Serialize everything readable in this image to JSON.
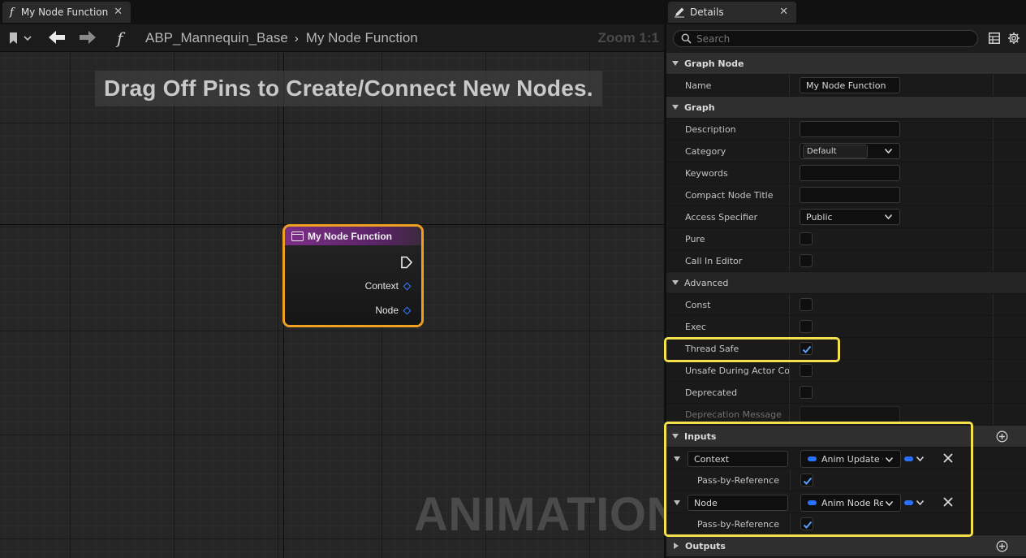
{
  "graph": {
    "tab_title": "My Node Function",
    "tab_close": "✕",
    "breadcrumb": [
      "ABP_Mannequin_Base",
      "My Node Function"
    ],
    "breadcrumb_sep": "›",
    "zoom": "Zoom 1:1",
    "hint": "Drag Off Pins to Create/Connect New Nodes.",
    "watermark": "ANIMATION",
    "node": {
      "title": "My Node Function",
      "pins": [
        "Context",
        "Node"
      ]
    },
    "colors": {
      "node_border": "#f0a020",
      "node_header": "#7b2f86",
      "pin": "#2e7dff"
    }
  },
  "details": {
    "tab_title": "Details",
    "tab_close": "✕",
    "search_placeholder": "Search",
    "sections": {
      "graph_node": "Graph Node",
      "graph": "Graph",
      "advanced": "Advanced",
      "inputs": "Inputs",
      "outputs": "Outputs"
    },
    "props": {
      "name_label": "Name",
      "name_value": "My Node Function",
      "description_label": "Description",
      "description_value": "",
      "category_label": "Category",
      "category_value": "Default",
      "keywords_label": "Keywords",
      "keywords_value": "",
      "compact_title_label": "Compact Node Title",
      "compact_title_value": "",
      "access_label": "Access Specifier",
      "access_value": "Public",
      "pure_label": "Pure",
      "pure_checked": false,
      "call_in_editor_label": "Call In Editor",
      "call_in_editor_checked": false,
      "const_label": "Const",
      "const_checked": false,
      "exec_label": "Exec",
      "exec_checked": false,
      "thread_safe_label": "Thread Safe",
      "thread_safe_checked": true,
      "unsafe_label": "Unsafe During Actor Cons",
      "unsafe_checked": false,
      "deprecated_label": "Deprecated",
      "deprecated_checked": false,
      "deprecation_msg_label": "Deprecation Message",
      "deprecation_msg_value": ""
    },
    "inputs": [
      {
        "name": "Context",
        "type": "Anim Update Context",
        "pass_by_ref_label": "Pass-by-Reference",
        "pass_by_ref": true
      },
      {
        "name": "Node",
        "type": "Anim Node Reference",
        "pass_by_ref_label": "Pass-by-Reference",
        "pass_by_ref": true
      }
    ],
    "colors": {
      "highlight": "#f3e04a",
      "type_pill": "#2a72ff",
      "check": "#5aa0ff"
    }
  }
}
